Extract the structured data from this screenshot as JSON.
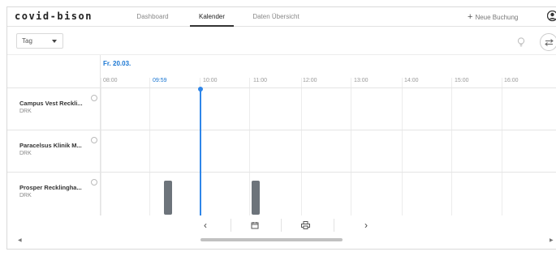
{
  "app": {
    "brand": "covid-bison"
  },
  "nav": {
    "tabs": [
      {
        "label": "Dashboard",
        "active": false
      },
      {
        "label": "Kalender",
        "active": true
      },
      {
        "label": "Daten Übersicht",
        "active": false
      }
    ],
    "new_booking_label": "Neue Buchung",
    "new_booking_icon": "plus-icon",
    "user_icon": "user-icon"
  },
  "toolbar": {
    "view_select": {
      "value": "Tag"
    },
    "bulb_icon": "lightbulb-icon",
    "swap_icon": "swap-icon"
  },
  "calendar": {
    "date": "Fr. 20.03.",
    "hours": [
      "08:00",
      "09:59",
      "10:00",
      "11:00",
      "12:00",
      "13:00",
      "14:00",
      "15:00",
      "16:00"
    ],
    "current_time": "09:59",
    "resources": [
      {
        "name": "Campus Vest Reckli...",
        "org": "DRK"
      },
      {
        "name": "Paracelsus Klinik M...",
        "org": "DRK"
      },
      {
        "name": "Prosper Recklingha...",
        "org": "DRK"
      }
    ]
  },
  "pager": {
    "prev_icon": "chevron-left-icon",
    "calendar_icon": "calendar-icon",
    "print_icon": "print-icon",
    "next_icon": "chevron-right-icon"
  },
  "colors": {
    "accent": "#2f86e8",
    "booking": "#6d747b"
  }
}
